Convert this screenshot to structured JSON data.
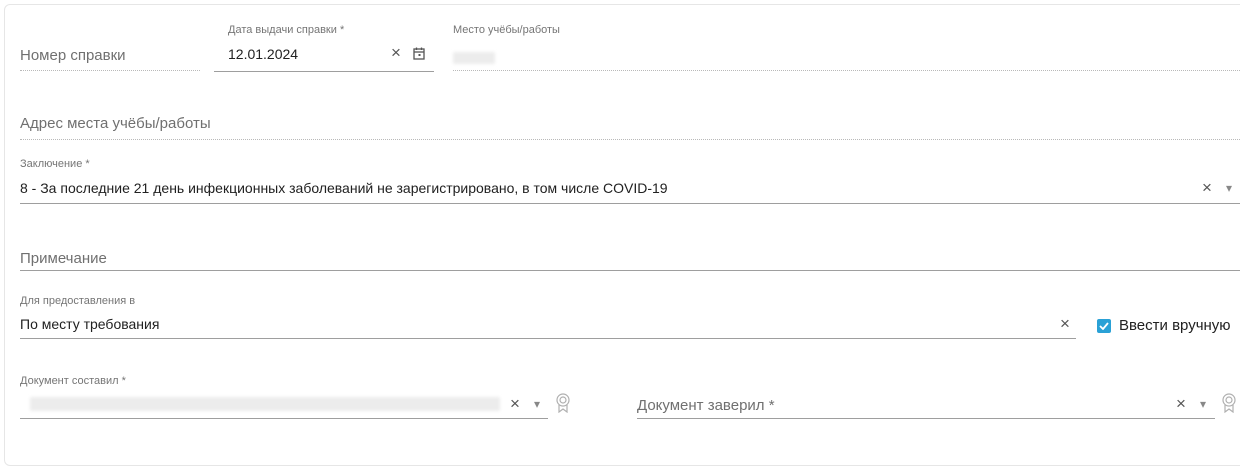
{
  "certificate_number": {
    "label": "Номер справки"
  },
  "issue_date": {
    "label": "Дата выдачи справки *",
    "value": "12.01.2024"
  },
  "study_work_place": {
    "label": "Место учёбы/работы"
  },
  "study_work_address": {
    "label": "Адрес места учёбы/работы"
  },
  "conclusion": {
    "label": "Заключение *",
    "value": "8 - За последние 21 день инфекционных заболеваний не зарегистрировано, в том числе COVID-19"
  },
  "note": {
    "label": "Примечание"
  },
  "provide_to": {
    "label": "Для предоставления в",
    "value": "По месту требования"
  },
  "manual_entry": {
    "label": "Ввести вручную",
    "checked": true
  },
  "document_compiled_by": {
    "label": "Документ составил *"
  },
  "document_certified_by": {
    "label": "Документ заверил *"
  },
  "icons": {
    "clear": "×",
    "dropdown": "▾",
    "calendar": "calendar-icon",
    "badge": "certificate-icon"
  },
  "colors": {
    "accent": "#2aa1d6",
    "line": "#9e9e9e",
    "muted": "#757575"
  }
}
